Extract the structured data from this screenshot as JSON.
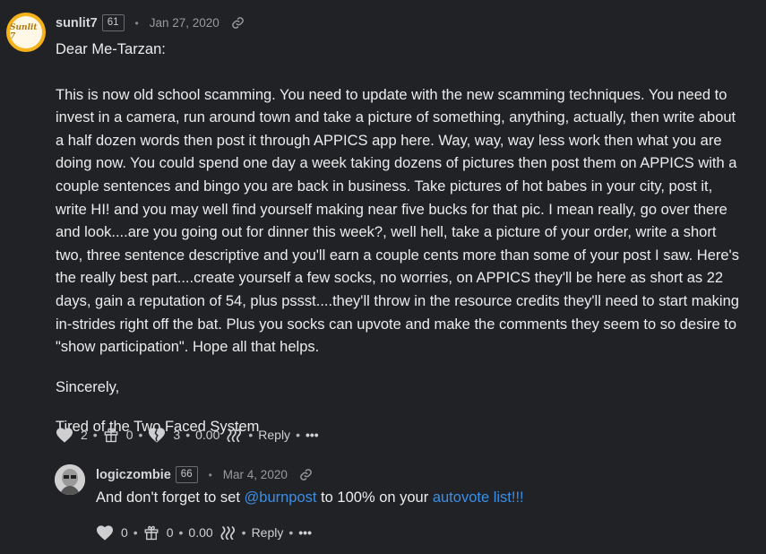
{
  "comment": {
    "avatar_text": "Sunlit 7",
    "username": "sunlit7",
    "reputation": "61",
    "date": "Jan 27, 2020",
    "greeting": "Dear Me-Tarzan:",
    "paragraph": "This is now old school scamming. You need to update with the new scamming techniques. You need to invest in a camera, run around town and take a picture of something, anything, actually, then write about a half dozen words then post it through APPICS app here. Way, way, way less work then what you are doing now. You could spend one day a week taking dozens of pictures then post them on APPICS with a couple sentences and bingo you are back in business. Take pictures of hot babes in your city, post it, write HI! and you may well find yourself making near five bucks for that pic. I mean really, go over there and look....are you going out for dinner this week?, well hell, take a picture of your order, write a short two, three sentence descriptive and you'll earn a couple cents more than some of your post I saw. Here's the really best part....create yourself a few socks, no worries, on APPICS they'll be here as short as 22 days, gain a reputation of 54, plus pssst....they'll throw in the resource credits they'll need to start making in-strides right off the bat. Plus you socks can upvote and make the comments they seem to so desire to \"show participation\". Hope all that helps.",
    "closing": "Sincerely,",
    "signature": "Tired of the Two Faced System",
    "footer": {
      "likes": "2",
      "gifts": "0",
      "flags": "3",
      "payout": "0.00",
      "reply": "Reply",
      "more": "•••"
    }
  },
  "reply": {
    "username": "logiczombie",
    "reputation": "66",
    "date": "Mar 4, 2020",
    "text_before": "And don't forget to set ",
    "mention": "@burnpost",
    "text_middle": " to 100% on your ",
    "link": "autovote list!!!",
    "footer": {
      "likes": "0",
      "gifts": "0",
      "payout": "0.00",
      "reply": "Reply",
      "more": "•••"
    }
  },
  "colors": {
    "background": "#212225",
    "link": "#3a8fe6",
    "avatar_bg": "#f6b21a"
  }
}
